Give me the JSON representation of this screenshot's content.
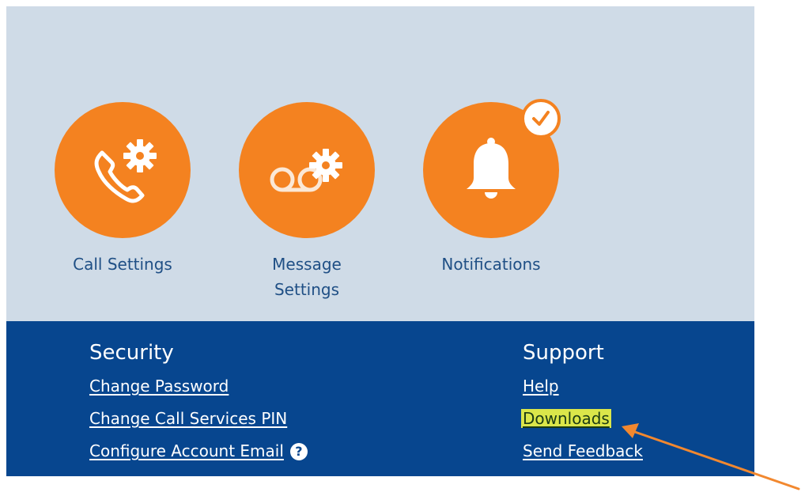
{
  "tiles": [
    {
      "label": "Call Settings",
      "icon": "phone-gear-icon"
    },
    {
      "label": "Message\nSettings",
      "icon": "voicemail-gear-icon"
    },
    {
      "label": "Notifications",
      "icon": "bell-icon"
    }
  ],
  "notifications_badge": {
    "icon": "check-icon"
  },
  "security": {
    "heading": "Security",
    "links": [
      "Change Password",
      "Change Call Services PIN",
      "Configure Account Email"
    ],
    "help_icon_glyph": "?"
  },
  "support": {
    "heading": "Support",
    "links": [
      "Help",
      "Downloads",
      "Send Feedback"
    ]
  },
  "annotation": {
    "arrow_icon": "arrow-icon",
    "highlighted_link": "Downloads"
  },
  "colors": {
    "accent_orange": "#f48220",
    "top_panel_bg": "#cfdbe7",
    "footer_bg": "#07468f",
    "highlight": "#dbe64a"
  }
}
